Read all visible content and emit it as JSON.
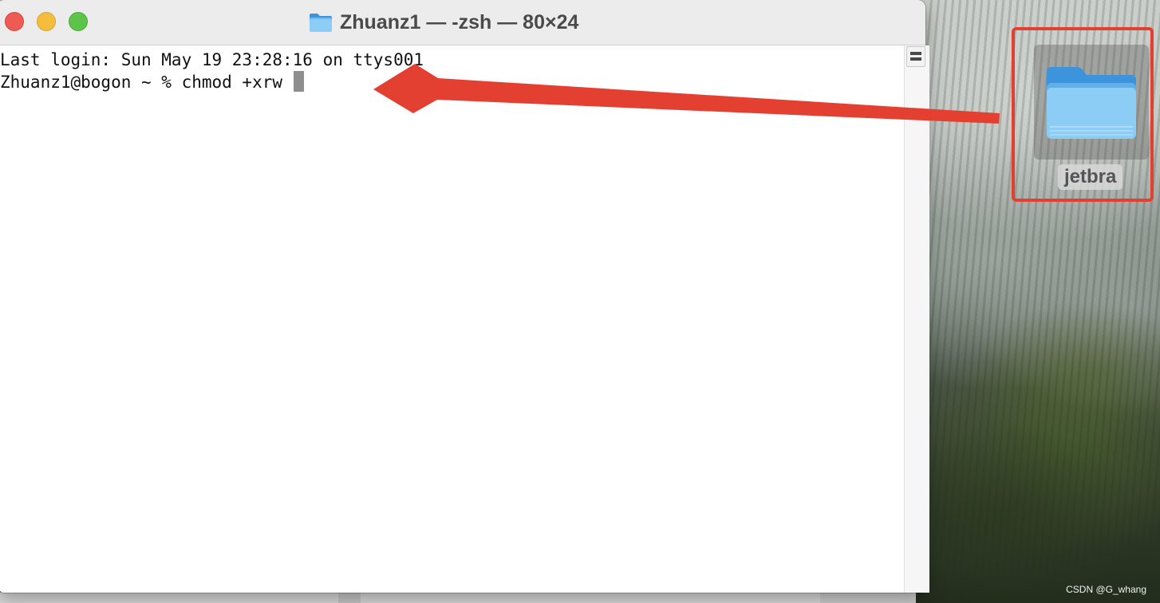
{
  "window": {
    "title": "Zhuanz1 — -zsh — 80×24"
  },
  "terminal": {
    "lines": [
      "Last login: Sun May 19 23:28:16 on ttys001",
      "Zhuanz1@bogon ~ % chmod +xrw "
    ]
  },
  "desktop": {
    "item_label": "jetbra",
    "watermark": "CSDN @G_whang"
  },
  "colors": {
    "annotation": "#e44032",
    "folder": "#8ccdf5"
  },
  "icons": {
    "title": "folder-icon",
    "desktop_item": "folder-icon",
    "scroll_control": "split-pane-icon"
  }
}
